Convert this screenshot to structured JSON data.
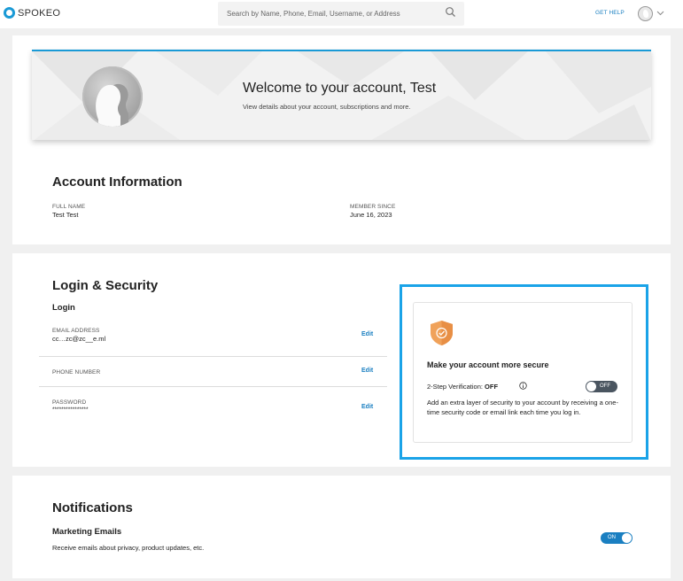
{
  "header": {
    "brand": "SPOKEO",
    "search_placeholder": "Search by Name, Phone, Email, Username, or Address",
    "get_help": "GET HELP",
    "icons": [
      "spokeo-logo-icon",
      "search-icon",
      "avatar-icon",
      "chevron-down-icon"
    ]
  },
  "welcome": {
    "title": "Welcome to your account, Test",
    "subtitle": "View details about your account, subscriptions and more."
  },
  "account": {
    "title": "Account Information",
    "full_name_label": "FULL NAME",
    "full_name_value": "Test Test",
    "member_since_label": "MEMBER SINCE",
    "member_since_value": "June 16, 2023"
  },
  "login": {
    "title": "Login & Security",
    "subtitle": "Login",
    "email_label": "EMAIL ADDRESS",
    "email_value": "cc…zc@zc__e.ml",
    "phone_label": "PHONE NUMBER",
    "password_label": "PASSWORD",
    "password_value": "****************",
    "edit_label": "Edit"
  },
  "secure": {
    "title": "Make your account more secure",
    "twostep_label": "2-Step Verification: ",
    "twostep_state": "OFF",
    "toggle_text": "OFF",
    "description": "Add an extra layer of security to your account by receiving a one-time security code or email link each time you log in.",
    "accent": "#1aa3e8",
    "shield_color": "#f0a25a"
  },
  "notifications": {
    "title": "Notifications",
    "marketing_title": "Marketing Emails",
    "marketing_desc": "Receive emails about privacy, product updates, etc.",
    "toggle_text": "ON"
  },
  "colors": {
    "brand_blue": "#1a9ad6",
    "link_blue": "#1a7fc1",
    "page_bg": "#f0f0f0"
  }
}
